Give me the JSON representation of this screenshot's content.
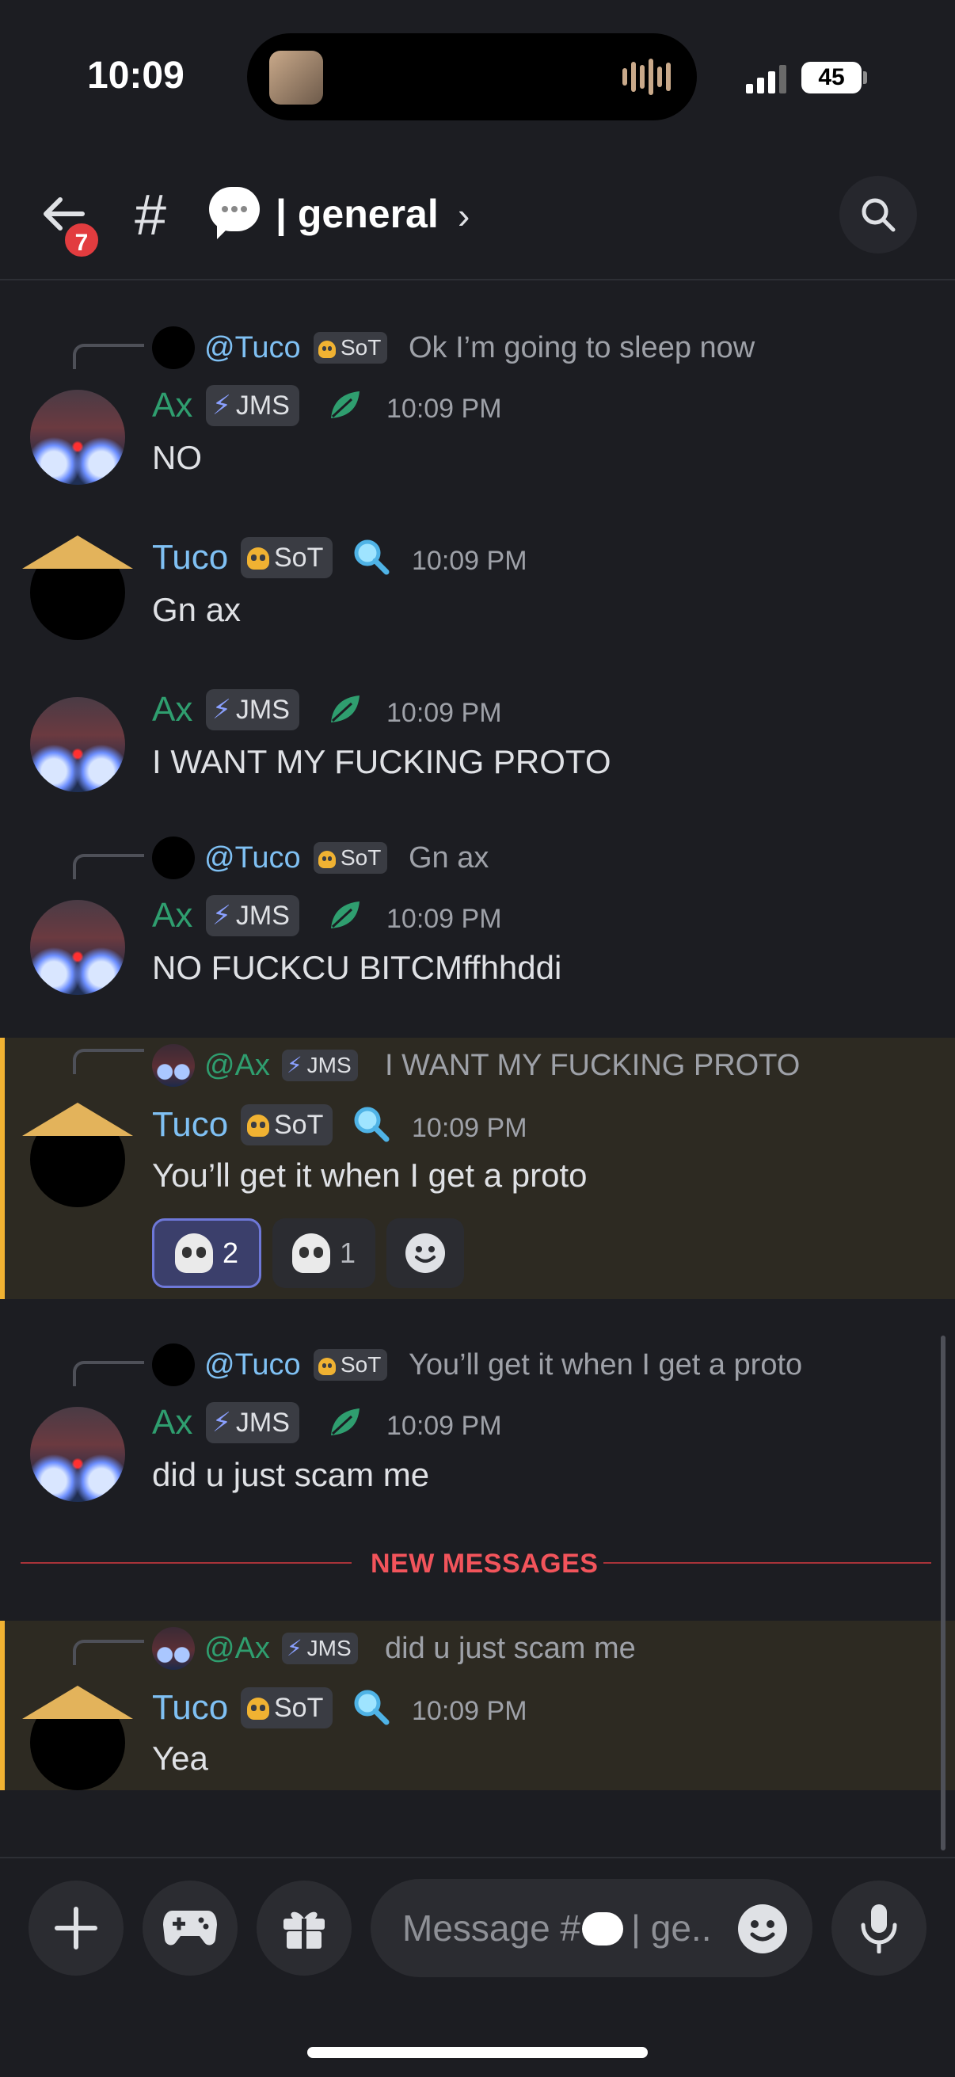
{
  "status_bar": {
    "time": "10:09",
    "battery": "45",
    "icons": [
      "signal-icon",
      "battery-icon",
      "audio-wave-icon"
    ]
  },
  "header": {
    "back_badge": "7",
    "channel_hash": "#",
    "channel_name": "| general",
    "chevron": "›"
  },
  "messages": [
    {
      "reply": {
        "name": "@Tuco",
        "tag": "SoT",
        "text": "Ok I’m going to sleep now"
      },
      "author": "Ax",
      "tag": "JMS",
      "time": "10:09 PM",
      "text": "NO"
    },
    {
      "author": "Tuco",
      "tag": "SoT",
      "time": "10:09 PM",
      "text": "Gn ax"
    },
    {
      "author": "Ax",
      "tag": "JMS",
      "time": "10:09 PM",
      "text": "I WANT MY FUCKING PROTO"
    },
    {
      "reply": {
        "name": "@Tuco",
        "tag": "SoT",
        "text": "Gn ax"
      },
      "author": "Ax",
      "tag": "JMS",
      "time": "10:09 PM",
      "text": "NO FUCKCU BITCMffhhddi"
    },
    {
      "reply": {
        "name": "@Ax",
        "tag": "JMS",
        "text": "I WANT MY FUCKING PROTO"
      },
      "author": "Tuco",
      "tag": "SoT",
      "time": "10:09 PM",
      "text": "You’ll get it when I get a proto",
      "reactions": [
        {
          "emoji": "skull-crossbones",
          "count": "2"
        },
        {
          "emoji": "skull",
          "count": "1"
        }
      ]
    },
    {
      "reply": {
        "name": "@Tuco",
        "tag": "SoT",
        "text": "You’ll get it when I get a proto"
      },
      "author": "Ax",
      "tag": "JMS",
      "time": "10:09 PM",
      "text": "did u just scam me"
    },
    {
      "reply": {
        "name": "@Ax",
        "tag": "JMS",
        "text": "did u just scam me"
      },
      "author": "Tuco",
      "tag": "SoT",
      "time": "10:09 PM",
      "text": "Yea"
    }
  ],
  "new_messages_label": "NEW MESSAGES",
  "composer": {
    "placeholder_prefix": "Message #",
    "placeholder_suffix": "| ge.."
  },
  "colors": {
    "background": "#1c1d22",
    "ax_name": "#2f9e6f",
    "tuco_name": "#7fc0f3",
    "new_messages": "#f2545b",
    "mention_highlight_bar": "#f0b232"
  }
}
